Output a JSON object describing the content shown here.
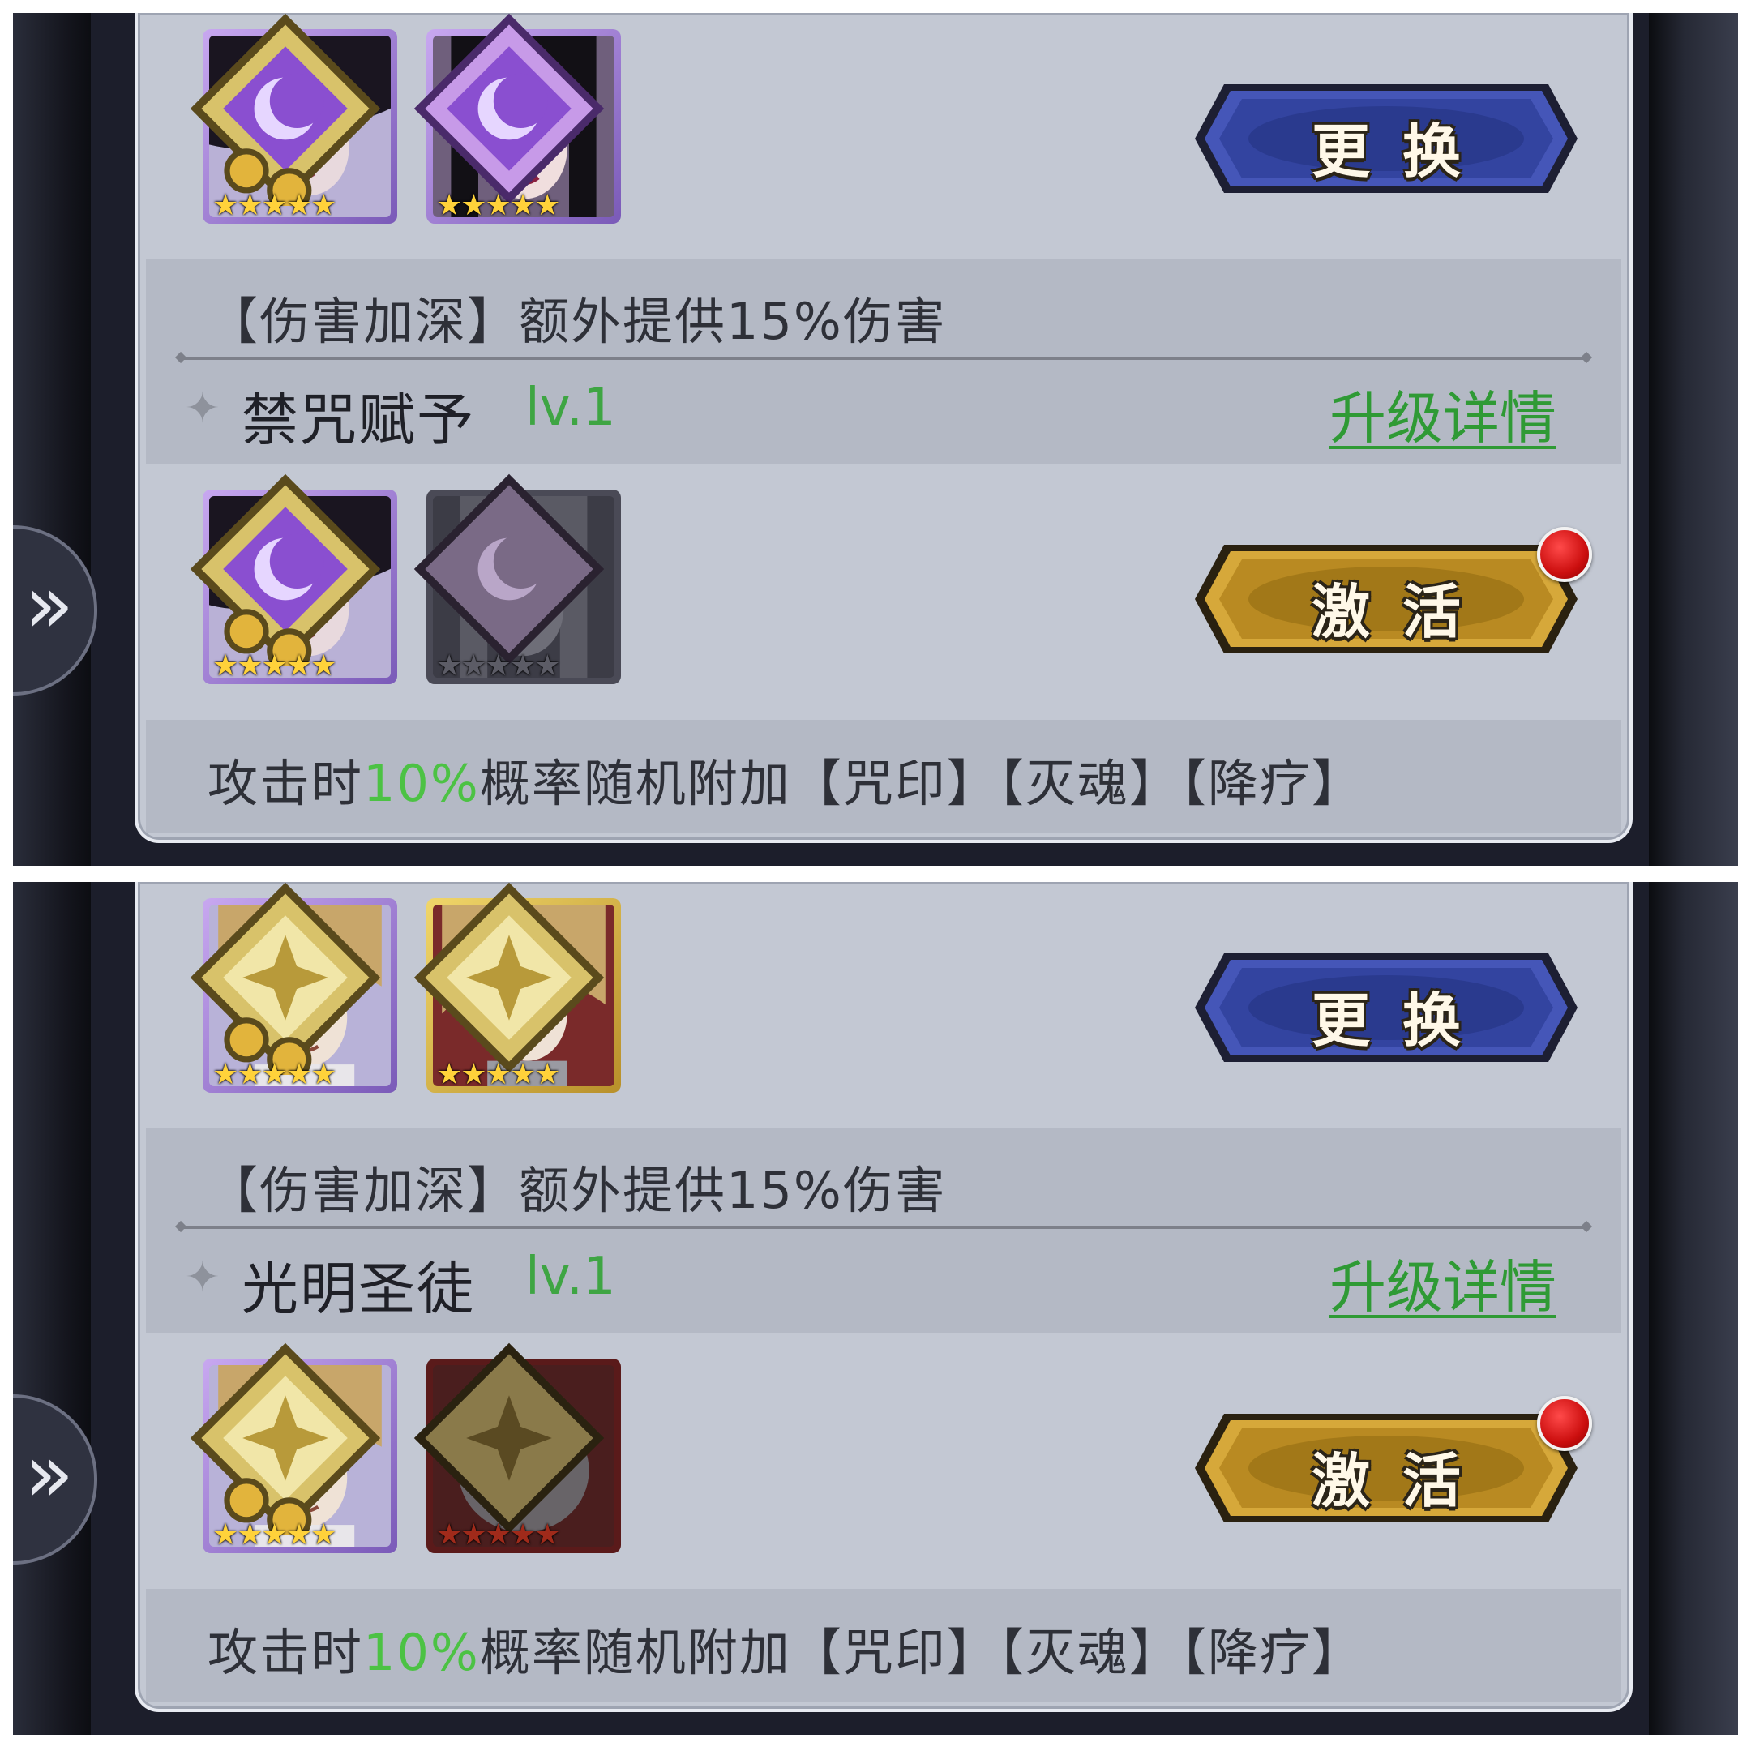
{
  "shots": [
    {
      "bonus_line": "【伤害加深】额外提供15%伤害",
      "skill": {
        "name": "禁咒赋予",
        "level": "lv.1",
        "upgrade_link": "升级详情"
      },
      "top_button": "更换",
      "bottom_button": "激活",
      "effect": {
        "prefix": "攻击时",
        "chance": "10%",
        "suffix": "概率随机附加【咒印】【灭魂】【降疗】"
      },
      "side_arrow": "»"
    },
    {
      "bonus_line": "【伤害加深】额外提供15%伤害",
      "skill": {
        "name": "光明圣徒",
        "level": "lv.1",
        "upgrade_link": "升级详情"
      },
      "top_button": "更换",
      "bottom_button": "激活",
      "effect": {
        "prefix": "攻击时",
        "chance": "10%",
        "suffix": "概率随机附加【咒印】【灭魂】【降疗】"
      },
      "side_arrow": "»"
    }
  ],
  "stars": "★★★★★",
  "colors": {
    "accent_green": "#4cc244",
    "link_green": "#2f9a35",
    "swap_button": "#3f4fb0",
    "activate_button": "#c89a2a",
    "notify_dot": "#d81b1b"
  },
  "icons": [
    "moon-faction-badge",
    "light-faction-badge",
    "star-rating-icon",
    "red-notification-dot",
    "side-expand-arrow-icon"
  ]
}
